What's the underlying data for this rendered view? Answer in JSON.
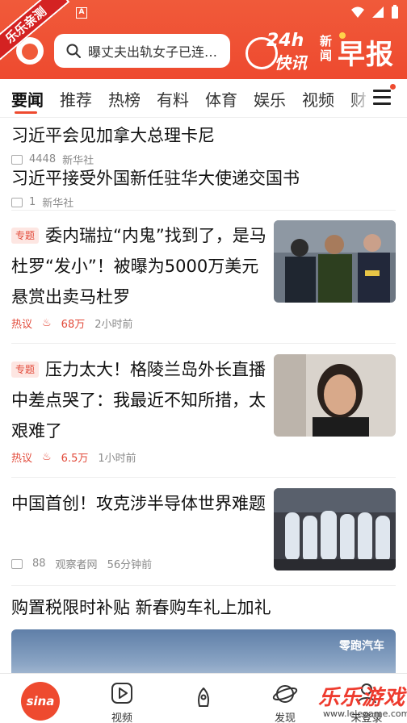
{
  "status_bar": {
    "notification_letter": "A"
  },
  "corner_banner": "乐乐亲测",
  "search": {
    "placeholder": "曝丈夫出轨女子已连…"
  },
  "brand": {
    "hours": "24h",
    "quick": "快讯",
    "news": "新闻",
    "morning": "早报"
  },
  "tabs": [
    "要闻",
    "推荐",
    "热榜",
    "有料",
    "体育",
    "娱乐",
    "视频",
    "财"
  ],
  "active_tab": "要闻",
  "top_news": [
    {
      "title": "习近平会见加拿大总理卡尼",
      "comments": "4448",
      "source": "新华社"
    },
    {
      "title": "习近平接受外国新任驻华大使递交国书",
      "comments": "1",
      "source": "新华社"
    }
  ],
  "cards": [
    {
      "tag": "专题",
      "title": "委内瑞拉“内鬼”找到了，是马杜罗“发小”！被曝为5000万美元悬赏出卖马杜罗",
      "label": "热议",
      "heat": "68万",
      "time": "2小时前"
    },
    {
      "tag": "专题",
      "title": "压力太大！格陵兰岛外长直播中差点哭了：我最近不知所措，太艰难了",
      "label": "热议",
      "heat": "6.5万",
      "time": "1小时前"
    },
    {
      "title": "中国首创！攻克涉半导体世界难题",
      "comments": "88",
      "source": "观察者网",
      "time": "56分钟前"
    }
  ],
  "ad": {
    "title": "购置税限时补贴 新春购车礼上加礼",
    "brand": "零跑汽车"
  },
  "bottom_nav": {
    "home": "sina",
    "video": "视频",
    "explore": "",
    "discover": "发现",
    "me": "未登录"
  },
  "watermark": {
    "text": "乐乐游戏",
    "url": "www.lelegame.com"
  }
}
